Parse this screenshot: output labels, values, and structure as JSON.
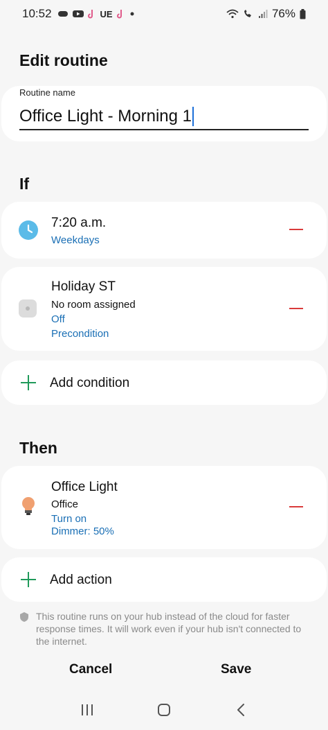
{
  "status_bar": {
    "time": "10:52",
    "carrier_text": "UE",
    "battery_percent": "76%",
    "icons": [
      "game-controller-icon",
      "youtube-icon",
      "tiktok-icon",
      "ue-icon",
      "tiktok-icon",
      "dot-icon",
      "wifi-icon",
      "wifi-call-icon",
      "signal-icon",
      "battery-icon"
    ]
  },
  "page": {
    "title": "Edit routine"
  },
  "routine_name": {
    "label": "Routine name",
    "value": "Office Light - Morning 1"
  },
  "if_section": {
    "title": "If",
    "conditions": [
      {
        "icon": "clock-icon",
        "title": "7:20 a.m.",
        "lines": [],
        "links": [
          "Weekdays"
        ]
      },
      {
        "icon": "device-icon",
        "title": "Holiday ST",
        "lines": [
          "No room assigned"
        ],
        "links": [
          "Off",
          "Precondition"
        ]
      }
    ],
    "add_label": "Add condition"
  },
  "then_section": {
    "title": "Then",
    "actions": [
      {
        "icon": "light-bulb-icon",
        "title": "Office Light",
        "lines": [
          "Office"
        ],
        "links": [
          "Turn on",
          "Dimmer: 50%"
        ]
      }
    ],
    "add_label": "Add action"
  },
  "info": {
    "text": "This routine runs on your hub instead of the cloud for faster response times. It will work even if your hub isn't connected to the internet."
  },
  "buttons": {
    "cancel": "Cancel",
    "save": "Save"
  },
  "colors": {
    "accent_link": "#1a6fb5",
    "remove": "#d93a3a",
    "add": "#1f9a5a",
    "clock": "#5bbbe8",
    "bulb": "#f0a070"
  }
}
